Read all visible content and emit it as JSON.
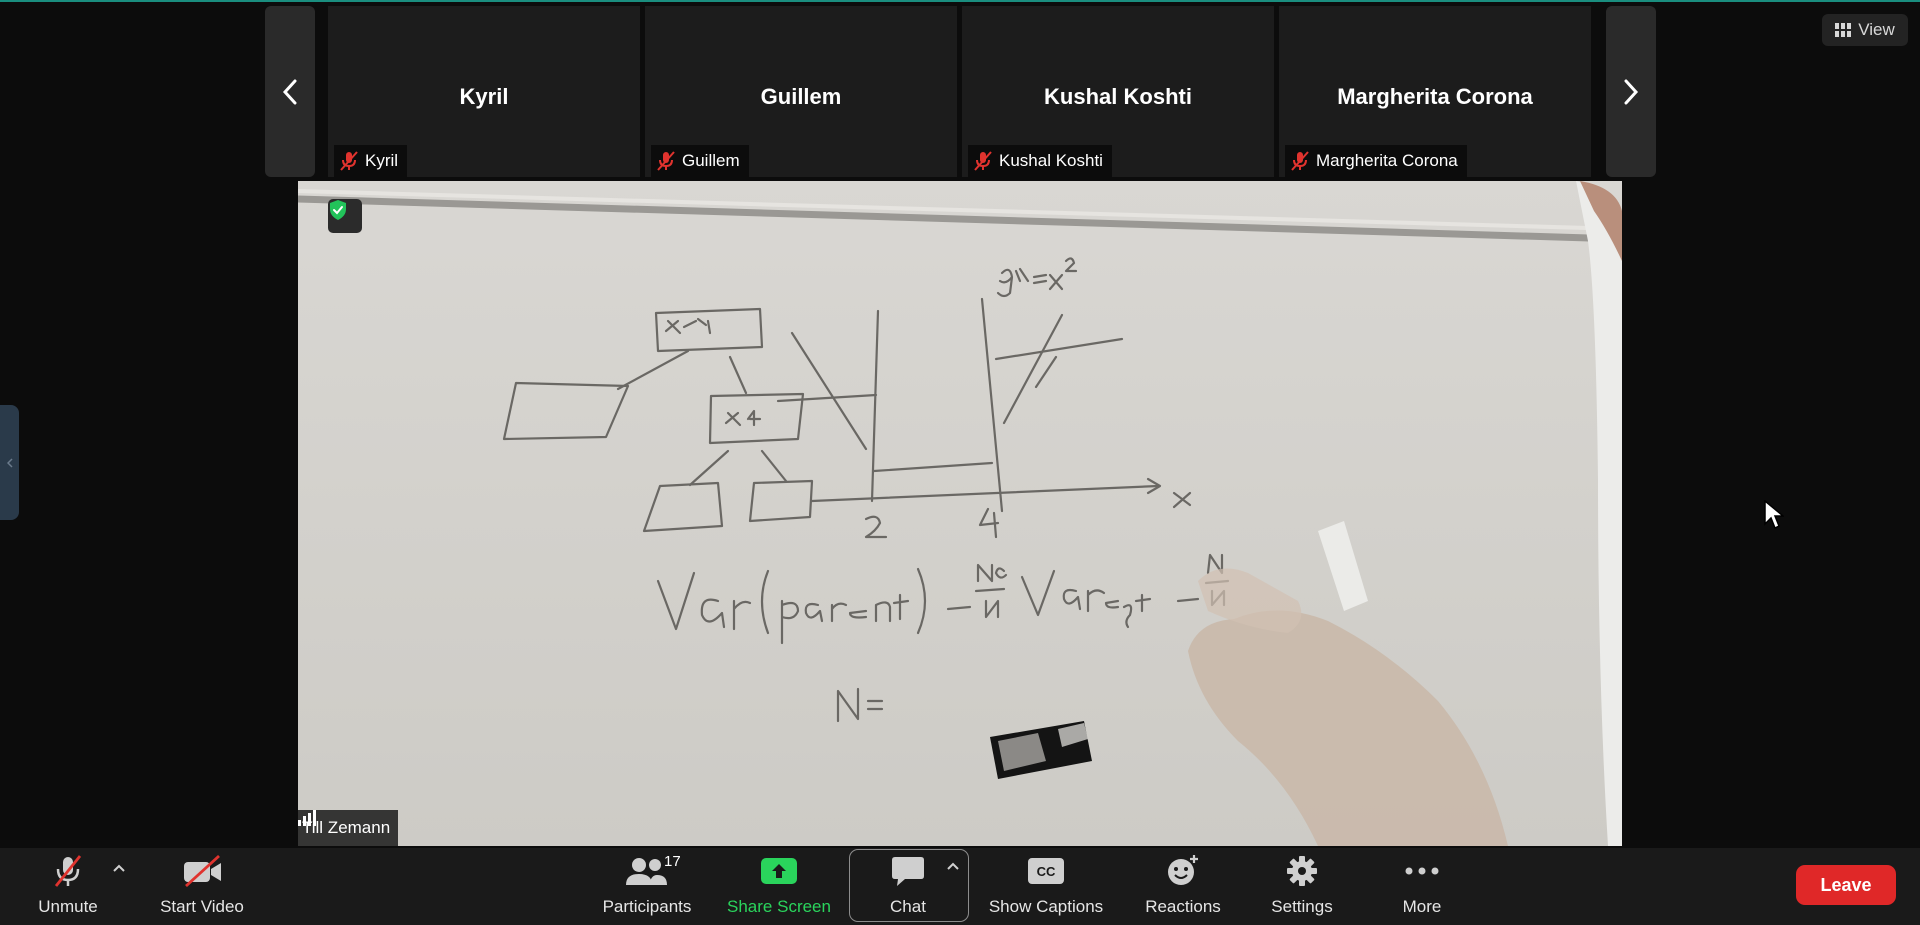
{
  "view_button": {
    "label": "View",
    "icon": "grid-view-icon"
  },
  "gallery": {
    "prev_icon": "chevron-left-icon",
    "next_icon": "chevron-right-icon",
    "participants": [
      {
        "name": "Kyril",
        "label": "Kyril",
        "muted": true
      },
      {
        "name": "Guillem",
        "label": "Guillem",
        "muted": true
      },
      {
        "name": "Kushal Koshti",
        "label": "Kushal Koshti",
        "muted": true
      },
      {
        "name": "Margherita Corona",
        "label": "Margherita Corona",
        "muted": true
      }
    ]
  },
  "main_video": {
    "speaker": "Till Zemann",
    "encryption_icon": "shield-check-icon"
  },
  "toolbar": {
    "unmute": "Unmute",
    "start_video": "Start Video",
    "participants": "Participants",
    "participants_count": "17",
    "share_screen": "Share Screen",
    "chat": "Chat",
    "show_captions": "Show Captions",
    "captions_icon_text": "CC",
    "reactions": "Reactions",
    "settings": "Settings",
    "more": "More",
    "leave": "Leave"
  },
  "colors": {
    "background": "#0c0c0c",
    "toolbar": "#1a1a1a",
    "share_green": "#2ad45c",
    "leave_red": "#e02828",
    "muted_red": "#e0332e"
  }
}
